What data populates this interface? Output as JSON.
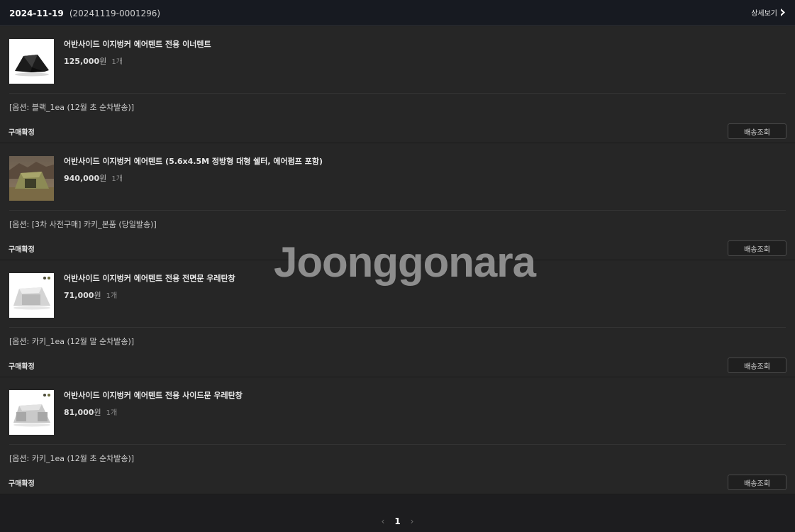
{
  "header": {
    "order_date": "2024-11-19",
    "order_number": "(20241119-0001296)",
    "detail_label": "상세보기"
  },
  "items": [
    {
      "name": "어반사이드 이지벙커 에어텐트 전용 이너텐트",
      "price": "125,000",
      "currency": "원",
      "quantity": "1개",
      "option": "[옵션: 블랙_1ea (12월 초 순차발송)]",
      "status": "구매확정",
      "track_label": "배송조회",
      "thumb_icon": "inner-tent-image"
    },
    {
      "name": "어반사이드 이지벙커 에어텐트 (5.6x4.5M 정방형 대형 쉘터, 에어펌프 포함)",
      "price": "940,000",
      "currency": "원",
      "quantity": "1개",
      "option": "[옵션: [3차 사전구매] 카키_본품 (당일발송)]",
      "status": "구매확정",
      "track_label": "배송조회",
      "thumb_icon": "air-tent-image"
    },
    {
      "name": "어반사이드 이지벙커 에어텐트 전용 전면문 우레탄창",
      "price": "71,000",
      "currency": "원",
      "quantity": "1개",
      "option": "[옵션: 카키_1ea (12월 말 순차발송)]",
      "status": "구매확정",
      "track_label": "배송조회",
      "thumb_icon": "front-window-image"
    },
    {
      "name": "어반사이드 이지벙커 에어텐트 전용 사이드문 우레탄창",
      "price": "81,000",
      "currency": "원",
      "quantity": "1개",
      "option": "[옵션: 카키_1ea (12월 초 순차발송)]",
      "status": "구매확정",
      "track_label": "배송조회",
      "thumb_icon": "side-window-image"
    }
  ],
  "watermark": "Joonggonara",
  "pagination": {
    "prev": "‹",
    "current": "1",
    "next": "›"
  }
}
